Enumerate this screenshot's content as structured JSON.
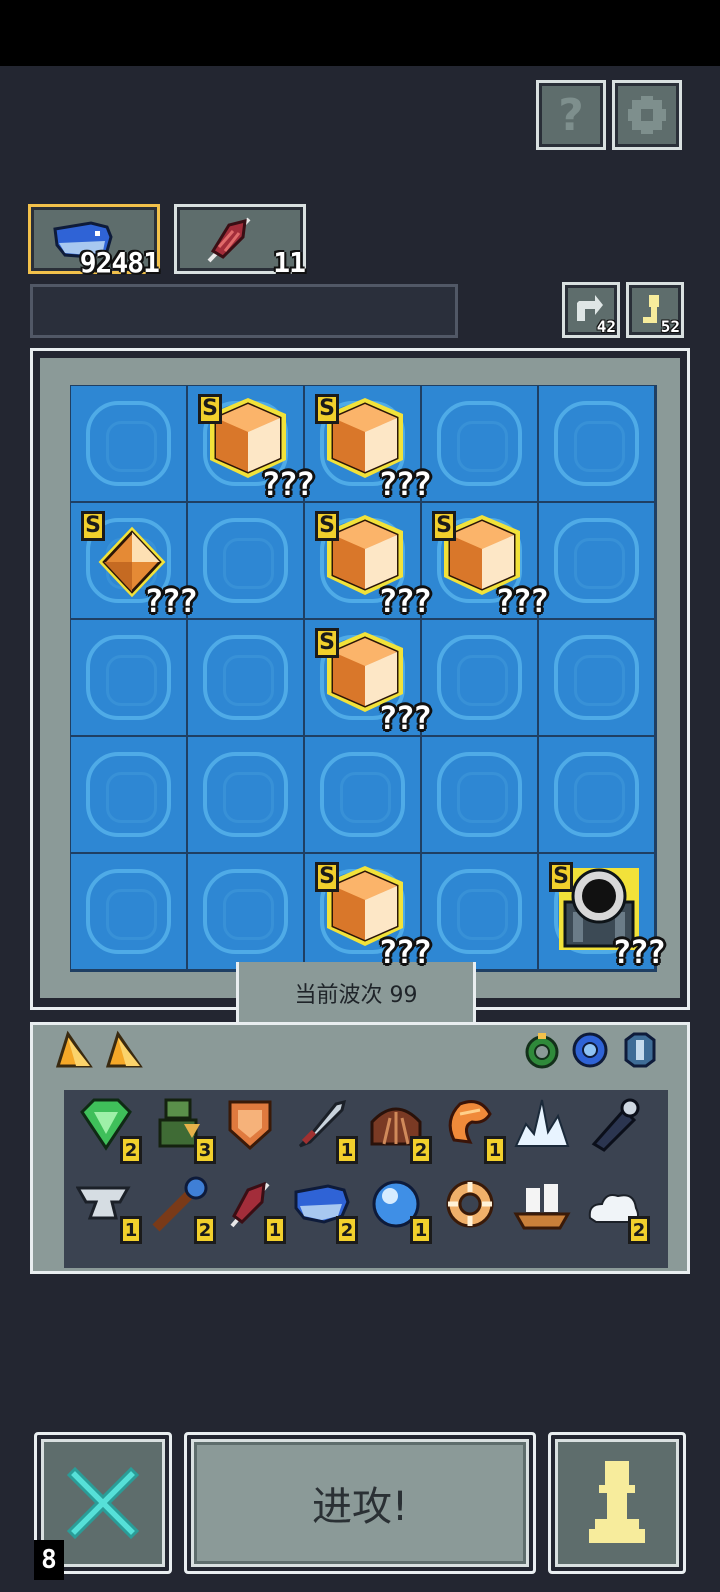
{
  "top_buttons": {
    "help_glyph": "?",
    "settings_icon": "gear-icon"
  },
  "resources": [
    {
      "name": "whale-icon",
      "count": "92481"
    },
    {
      "name": "feather-icon",
      "count": "11"
    }
  ],
  "counters": {
    "refresh": "42",
    "key": "52"
  },
  "board": {
    "wave_label": "当前波次 99",
    "unknown_label": "???",
    "rank_label": "S",
    "rows": [
      [
        "empty",
        "crystal",
        "crystal",
        "empty",
        "empty"
      ],
      [
        "crystal-small",
        "empty",
        "crystal",
        "crystal",
        "empty"
      ],
      [
        "empty",
        "empty",
        "crystal",
        "empty",
        "empty"
      ],
      [
        "empty",
        "empty",
        "empty",
        "empty",
        "empty"
      ],
      [
        "empty",
        "empty",
        "crystal",
        "empty",
        "cannon"
      ]
    ]
  },
  "inventory": {
    "tabs": [
      "orange-triangle-icon",
      "orange-triangle-icon"
    ],
    "filters": [
      "green-ring-icon",
      "blue-gear-icon",
      "blue-armor-icon"
    ],
    "items": [
      {
        "icon": "green-gem-icon",
        "qty": "2"
      },
      {
        "icon": "soldier-icon",
        "qty": "3"
      },
      {
        "icon": "bronze-shield-icon",
        "qty": ""
      },
      {
        "icon": "dagger-icon",
        "qty": "1"
      },
      {
        "icon": "shell-icon",
        "qty": "2"
      },
      {
        "icon": "shrimp-icon",
        "qty": "1"
      },
      {
        "icon": "ice-shard-icon",
        "qty": ""
      },
      {
        "icon": "spyglass-icon",
        "qty": ""
      },
      {
        "icon": "anvil-icon",
        "qty": "1"
      },
      {
        "icon": "staff-icon",
        "qty": "2"
      },
      {
        "icon": "red-feather-icon",
        "qty": "1"
      },
      {
        "icon": "whale-icon",
        "qty": "2"
      },
      {
        "icon": "bubble-icon",
        "qty": "1"
      },
      {
        "icon": "lifebuoy-icon",
        "qty": ""
      },
      {
        "icon": "ship-icon",
        "qty": ""
      },
      {
        "icon": "cloud-icon",
        "qty": "2"
      }
    ]
  },
  "bottom": {
    "attack_label": "进攻!",
    "cancel_icon": "cross-icon",
    "pawn_icon": "pawn-icon",
    "counter": "8"
  },
  "colors": {
    "background": "#232631",
    "tile": "#2e87d3",
    "frame": "#8b9a98",
    "badge": "#f2d02c",
    "crystal": "#f0a04b",
    "cancel": "#56e0d8",
    "pawn": "#f7ec9c"
  }
}
